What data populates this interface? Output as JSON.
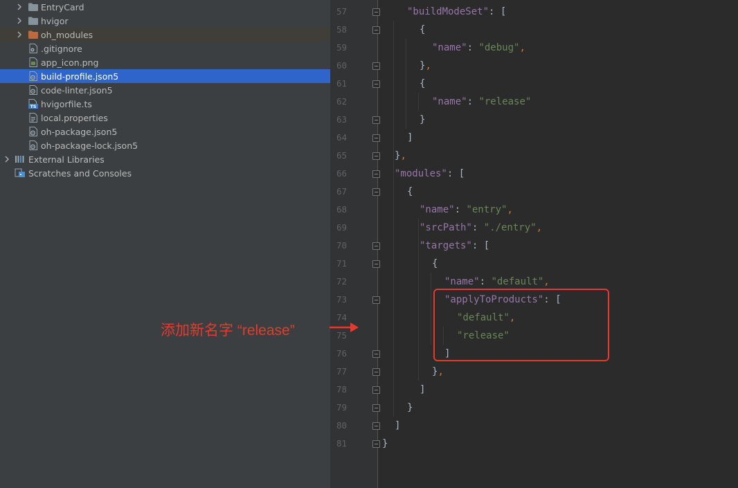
{
  "project_tree": {
    "items": [
      {
        "label": "EntryCard",
        "icon": "folder-icon",
        "expandable": true
      },
      {
        "label": "hvigor",
        "icon": "folder-icon",
        "expandable": true
      },
      {
        "label": "oh_modules",
        "icon": "folder-orange-icon",
        "expandable": true
      },
      {
        "label": ".gitignore",
        "icon": "gitignore-file-icon"
      },
      {
        "label": "app_icon.png",
        "icon": "image-file-icon"
      },
      {
        "label": "build-profile.json5",
        "icon": "json5-file-icon",
        "selected": true
      },
      {
        "label": "code-linter.json5",
        "icon": "json5-file-icon"
      },
      {
        "label": "hvigorfile.ts",
        "icon": "typescript-file-icon"
      },
      {
        "label": "local.properties",
        "icon": "properties-file-icon"
      },
      {
        "label": "oh-package.json5",
        "icon": "json5-file-icon"
      },
      {
        "label": "oh-package-lock.json5",
        "icon": "json5-file-icon"
      },
      {
        "label": "External Libraries",
        "icon": "library-icon",
        "expandable": true
      },
      {
        "label": "Scratches and Consoles",
        "icon": "scratch-icon"
      }
    ]
  },
  "editor": {
    "line_numbers": [
      "57",
      "58",
      "59",
      "60",
      "61",
      "62",
      "63",
      "64",
      "65",
      "66",
      "67",
      "68",
      "69",
      "70",
      "71",
      "72",
      "73",
      "74",
      "75",
      "76",
      "77",
      "78",
      "79",
      "80",
      "81"
    ],
    "lines": [
      [
        {
          "t": "\"buildModeSet\"",
          "c": "k"
        },
        {
          "t": ": [",
          "c": "p"
        }
      ],
      [
        {
          "t": "{",
          "c": "p"
        }
      ],
      [
        {
          "t": "\"name\"",
          "c": "k"
        },
        {
          "t": ": ",
          "c": "p"
        },
        {
          "t": "\"debug\"",
          "c": "s"
        },
        {
          "t": ",",
          "c": "c"
        }
      ],
      [
        {
          "t": "}",
          "c": "p"
        },
        {
          "t": ",",
          "c": "c"
        }
      ],
      [
        {
          "t": "{",
          "c": "p"
        }
      ],
      [
        {
          "t": "\"name\"",
          "c": "k"
        },
        {
          "t": ": ",
          "c": "p"
        },
        {
          "t": "\"release\"",
          "c": "s"
        }
      ],
      [
        {
          "t": "}",
          "c": "p"
        }
      ],
      [
        {
          "t": "]",
          "c": "p"
        }
      ],
      [
        {
          "t": "}",
          "c": "p"
        },
        {
          "t": ",",
          "c": "c"
        }
      ],
      [
        {
          "t": "\"modules\"",
          "c": "k"
        },
        {
          "t": ": [",
          "c": "p"
        }
      ],
      [
        {
          "t": "{",
          "c": "p"
        }
      ],
      [
        {
          "t": "\"name\"",
          "c": "k"
        },
        {
          "t": ": ",
          "c": "p"
        },
        {
          "t": "\"entry\"",
          "c": "s"
        },
        {
          "t": ",",
          "c": "c"
        }
      ],
      [
        {
          "t": "\"srcPath\"",
          "c": "k"
        },
        {
          "t": ": ",
          "c": "p"
        },
        {
          "t": "\"./entry\"",
          "c": "s"
        },
        {
          "t": ",",
          "c": "c"
        }
      ],
      [
        {
          "t": "\"targets\"",
          "c": "k"
        },
        {
          "t": ": [",
          "c": "p"
        }
      ],
      [
        {
          "t": "{",
          "c": "p"
        }
      ],
      [
        {
          "t": "\"name\"",
          "c": "k"
        },
        {
          "t": ": ",
          "c": "p"
        },
        {
          "t": "\"default\"",
          "c": "s"
        },
        {
          "t": ",",
          "c": "c"
        }
      ],
      [
        {
          "t": "\"applyToProducts\"",
          "c": "k"
        },
        {
          "t": ": [",
          "c": "p"
        }
      ],
      [
        {
          "t": "\"default\"",
          "c": "s"
        },
        {
          "t": ",",
          "c": "c"
        }
      ],
      [
        {
          "t": "\"release\"",
          "c": "s"
        }
      ],
      [
        {
          "t": "]",
          "c": "p"
        }
      ],
      [
        {
          "t": "}",
          "c": "p"
        },
        {
          "t": ",",
          "c": "c"
        }
      ],
      [
        {
          "t": "]",
          "c": "p"
        }
      ],
      [
        {
          "t": "}",
          "c": "p"
        }
      ],
      [
        {
          "t": "]",
          "c": "p"
        }
      ],
      [
        {
          "t": "}",
          "c": "p"
        }
      ]
    ]
  },
  "annotation": {
    "text": "添加新名字 “release”",
    "color": "#e8392f"
  },
  "colors": {
    "selection": "#2f65ca",
    "key": "#9876aa",
    "string": "#6a8759",
    "comma": "#cc7832"
  }
}
